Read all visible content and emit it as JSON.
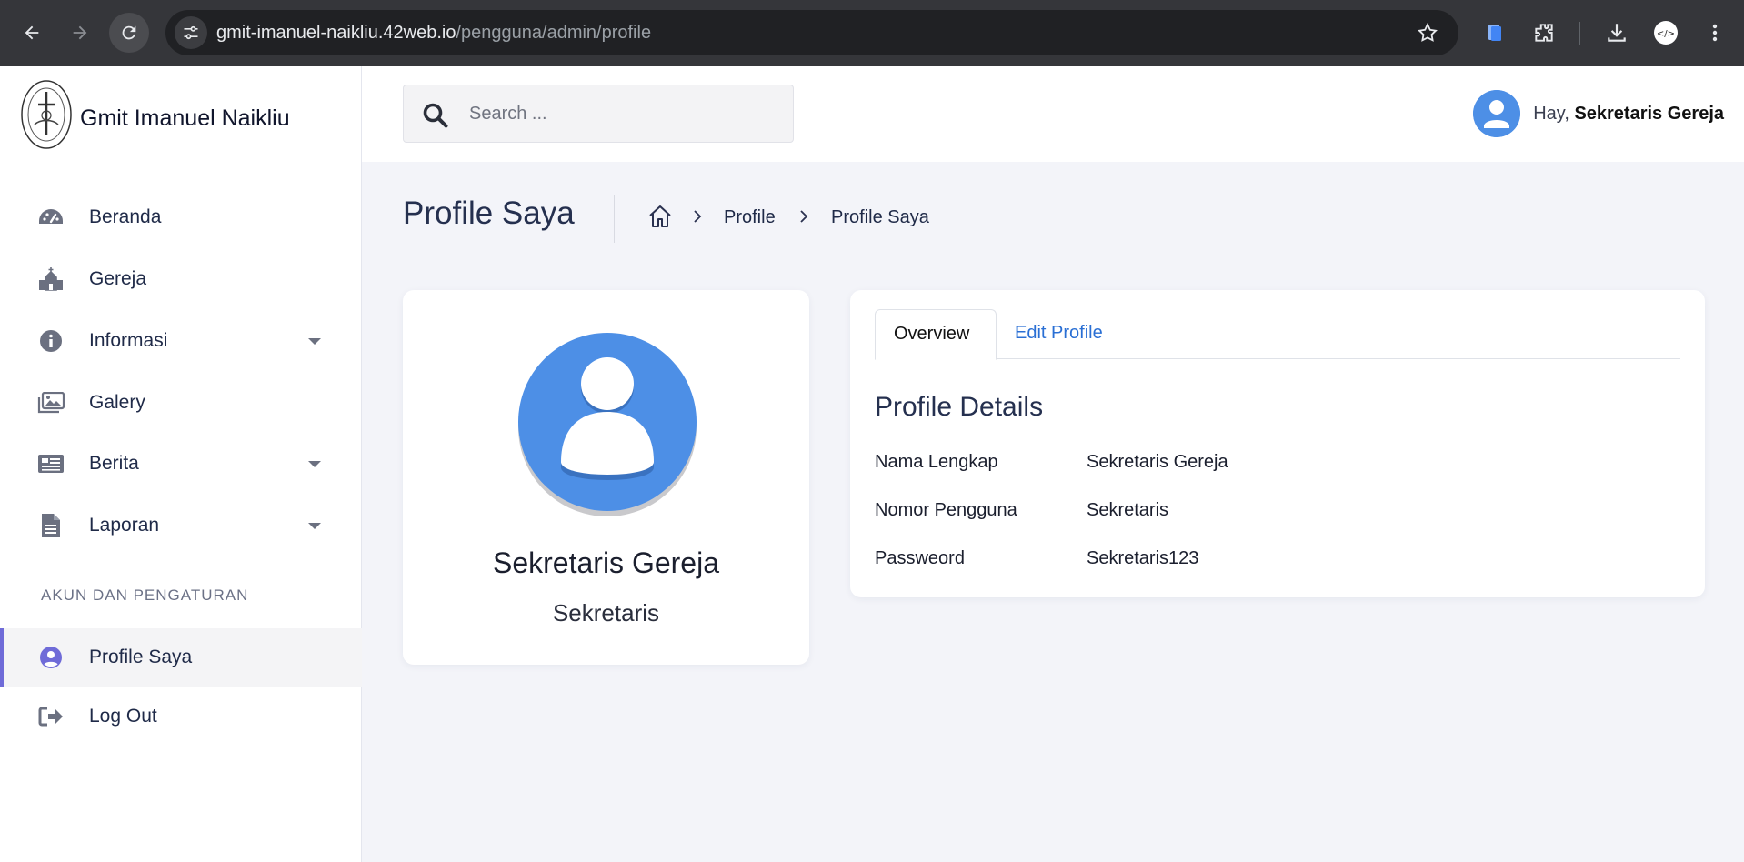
{
  "browser": {
    "url_host": "gmit-imanuel-naikliu.42web.io",
    "url_path": "/pengguna/admin/profile",
    "icons": [
      "back-icon",
      "forward-icon",
      "reload-icon",
      "site-settings-icon",
      "bookmark-star-icon",
      "docs-extension-icon",
      "puzzle-extension-icon",
      "download-icon",
      "profile-extension-icon",
      "more-vert-icon"
    ]
  },
  "sidebar": {
    "brand": "Gmit Imanuel Naikliu",
    "items": [
      {
        "label": "Beranda",
        "icon": "dashboard-icon"
      },
      {
        "label": "Gereja",
        "icon": "church-icon"
      },
      {
        "label": "Informasi",
        "icon": "info-icon",
        "has_caret": true
      },
      {
        "label": "Galery",
        "icon": "images-icon"
      },
      {
        "label": "Berita",
        "icon": "newspaper-icon",
        "has_caret": true
      },
      {
        "label": "Laporan",
        "icon": "file-icon",
        "has_caret": true
      }
    ],
    "section_label": "AKUN DAN PENGATURAN",
    "account_items": [
      {
        "label": "Profile Saya",
        "icon": "user-circle-icon",
        "active": true
      },
      {
        "label": "Log Out",
        "icon": "logout-icon"
      }
    ]
  },
  "header": {
    "search_placeholder": "Search ...",
    "greeting": "Hay,",
    "user_name": "Sekretaris Gereja"
  },
  "page": {
    "title": "Profile Saya",
    "breadcrumb": [
      "Profile",
      "Profile Saya"
    ]
  },
  "profile_card": {
    "name": "Sekretaris Gereja",
    "role": "Sekretaris"
  },
  "details": {
    "tabs": [
      "Overview",
      "Edit Profile"
    ],
    "title": "Profile Details",
    "rows": [
      {
        "label": "Nama Lengkap",
        "value": "Sekretaris Gereja"
      },
      {
        "label": "Nomor Pengguna",
        "value": "Sekretaris"
      },
      {
        "label": "Passweord",
        "value": "Sekretaris123"
      }
    ]
  },
  "colors": {
    "accent": "#6f6bd8",
    "avatar_blue": "#4d8fe6",
    "link": "#2a6fd4",
    "heading": "#25304f"
  }
}
